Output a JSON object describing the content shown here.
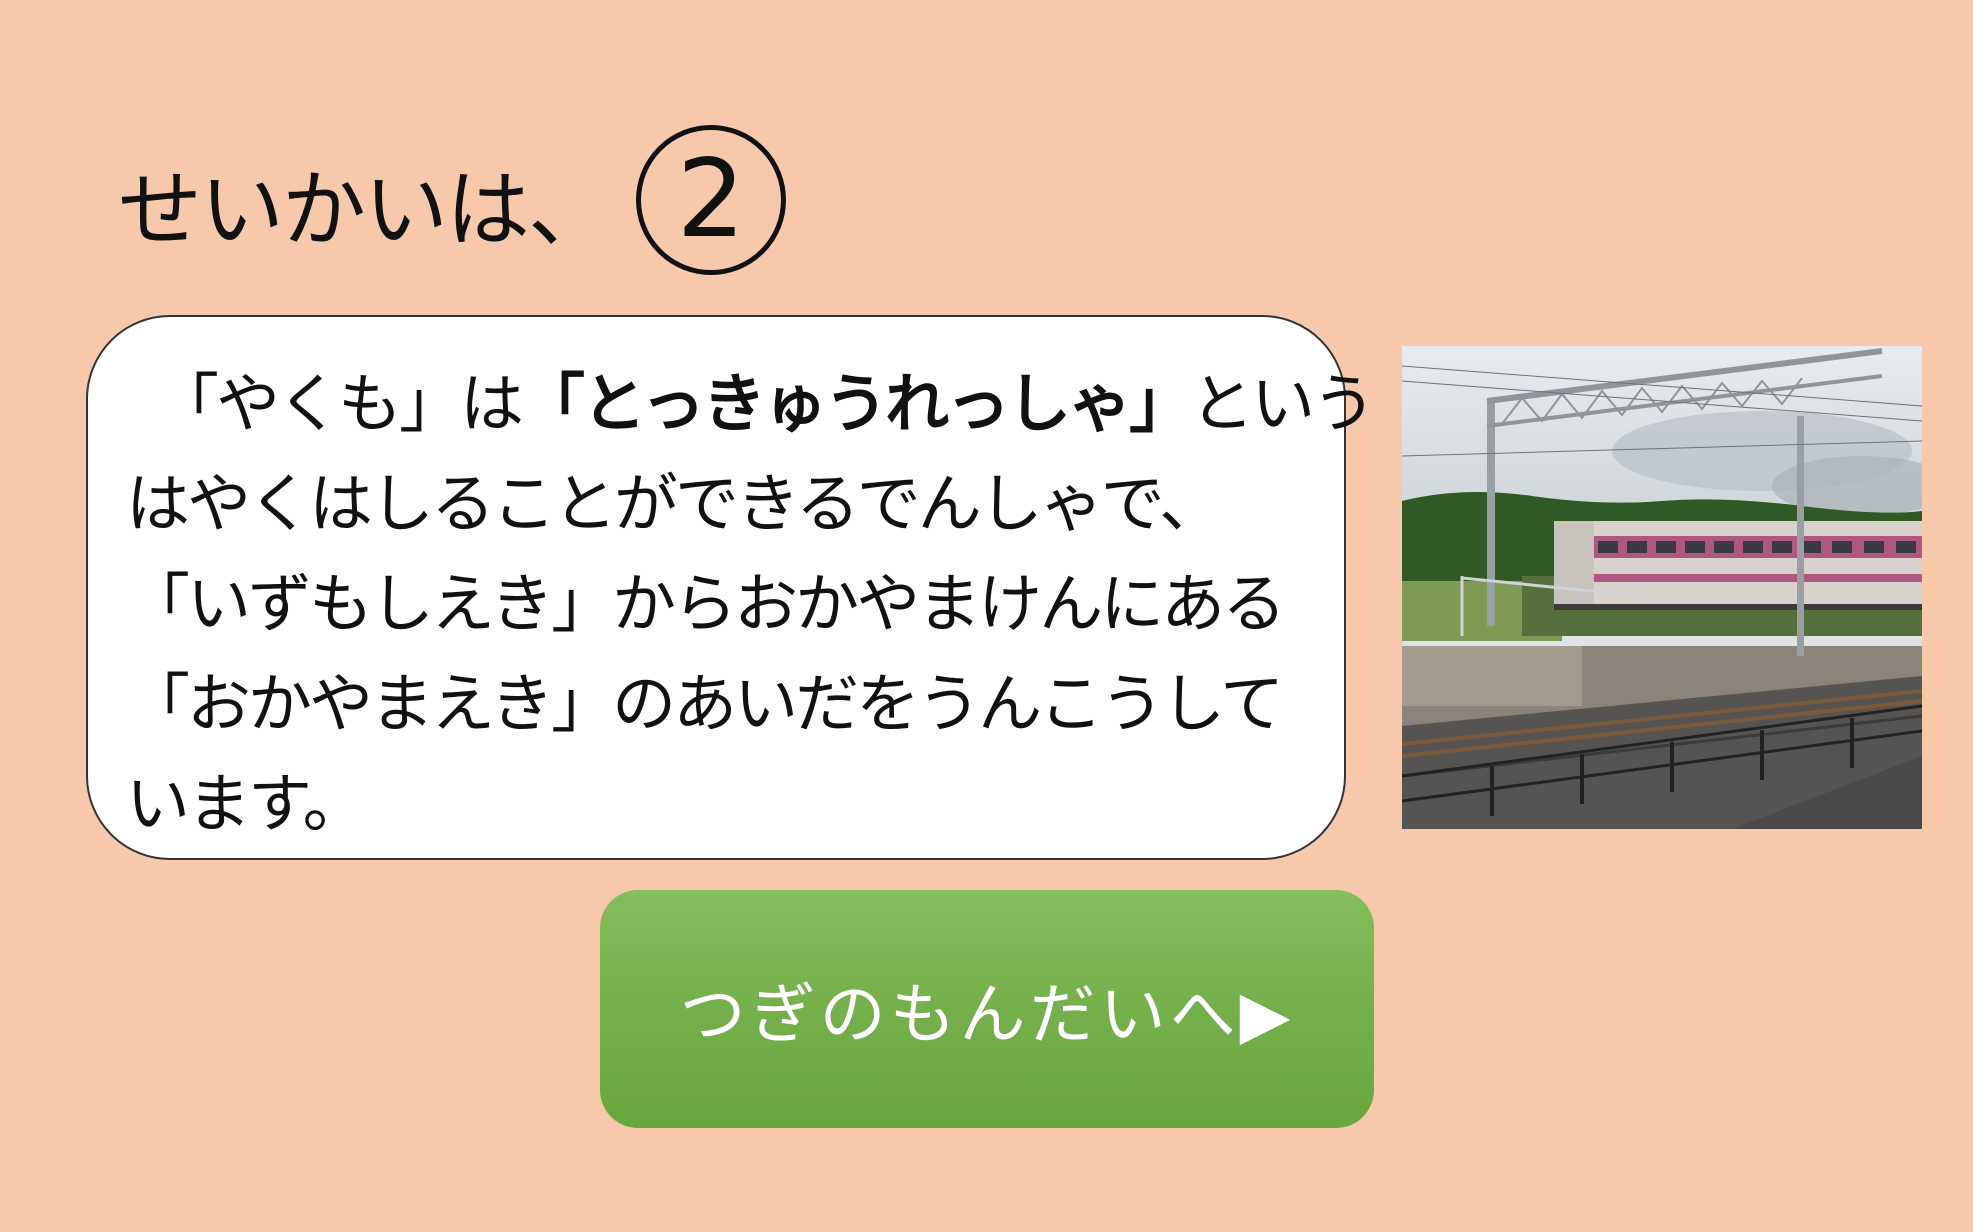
{
  "heading": {
    "text": "せいかいは、",
    "answer": "2"
  },
  "explanation": {
    "line1_indent": "　",
    "line1_pre": "「やくも」は",
    "line1_bold": "「とっきゅうれっしゃ」",
    "line1_post": "という",
    "line2": "はやくはしることができるでんしゃで、",
    "line3": "「いずもしえき」からおかやまけんにある",
    "line4": "「おかやまえき」のあいだをうんこうして",
    "line5": "います。"
  },
  "next_button": {
    "label": "つぎのもんだいへ▶"
  },
  "colors": {
    "background": "#f7c9aa",
    "bubble": "#ffffff",
    "button": "#74b04b",
    "button_text": "#ffffff"
  }
}
